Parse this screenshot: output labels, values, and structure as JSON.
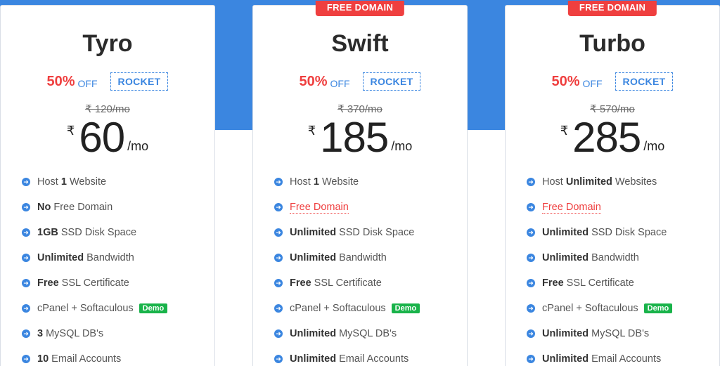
{
  "plans": [
    {
      "name": "Tyro",
      "ribbon": "",
      "discount_pct": "50%",
      "discount_off": "OFF",
      "coupon": "ROCKET",
      "old_price": "₹ 120/mo",
      "currency": "₹",
      "price": "60",
      "per": "/mo",
      "features": [
        {
          "pre": "Host ",
          "bold": "1",
          "post": " Website"
        },
        {
          "pre": "",
          "bold": "No",
          "post": " Free Domain"
        },
        {
          "pre": "",
          "bold": "1GB",
          "post": " SSD Disk Space"
        },
        {
          "pre": "",
          "bold": "Unlimited",
          "post": " Bandwidth"
        },
        {
          "pre": "",
          "bold": "Free",
          "post": " SSL Certificate"
        },
        {
          "pre": "cPanel + Softaculous",
          "bold": "",
          "post": "",
          "badge": "Demo"
        },
        {
          "pre": "",
          "bold": "3",
          "post": " MySQL DB's"
        },
        {
          "pre": "",
          "bold": "10",
          "post": " Email Accounts"
        }
      ]
    },
    {
      "name": "Swift",
      "ribbon": "FREE DOMAIN",
      "discount_pct": "50%",
      "discount_off": "OFF",
      "coupon": "ROCKET",
      "old_price": "₹ 370/mo",
      "currency": "₹",
      "price": "185",
      "per": "/mo",
      "features": [
        {
          "pre": "Host ",
          "bold": "1",
          "post": " Website"
        },
        {
          "pre": "Free Domain",
          "bold": "",
          "post": "",
          "red": true
        },
        {
          "pre": "",
          "bold": "Unlimited",
          "post": " SSD Disk Space"
        },
        {
          "pre": "",
          "bold": "Unlimited",
          "post": " Bandwidth"
        },
        {
          "pre": "",
          "bold": "Free",
          "post": " SSL Certificate"
        },
        {
          "pre": "cPanel + Softaculous",
          "bold": "",
          "post": "",
          "badge": "Demo"
        },
        {
          "pre": "",
          "bold": "Unlimited",
          "post": " MySQL DB's"
        },
        {
          "pre": "",
          "bold": "Unlimited",
          "post": " Email Accounts"
        }
      ]
    },
    {
      "name": "Turbo",
      "ribbon": "FREE DOMAIN",
      "discount_pct": "50%",
      "discount_off": "OFF",
      "coupon": "ROCKET",
      "old_price": "₹ 570/mo",
      "currency": "₹",
      "price": "285",
      "per": "/mo",
      "features": [
        {
          "pre": "Host ",
          "bold": "Unlimited",
          "post": " Websites"
        },
        {
          "pre": "Free Domain",
          "bold": "",
          "post": "",
          "red": true
        },
        {
          "pre": "",
          "bold": "Unlimited",
          "post": " SSD Disk Space"
        },
        {
          "pre": "",
          "bold": "Unlimited",
          "post": " Bandwidth"
        },
        {
          "pre": "",
          "bold": "Free",
          "post": " SSL Certificate"
        },
        {
          "pre": "cPanel + Softaculous",
          "bold": "",
          "post": "",
          "badge": "Demo"
        },
        {
          "pre": "",
          "bold": "Unlimited",
          "post": " MySQL DB's"
        },
        {
          "pre": "",
          "bold": "Unlimited",
          "post": " Email Accounts"
        }
      ]
    }
  ],
  "colors": {
    "accent": "#3b86e0",
    "red": "#ef3f3f",
    "green": "#19b34a"
  },
  "icons": {
    "feature_bullet": "arrow-right-circle-icon"
  }
}
